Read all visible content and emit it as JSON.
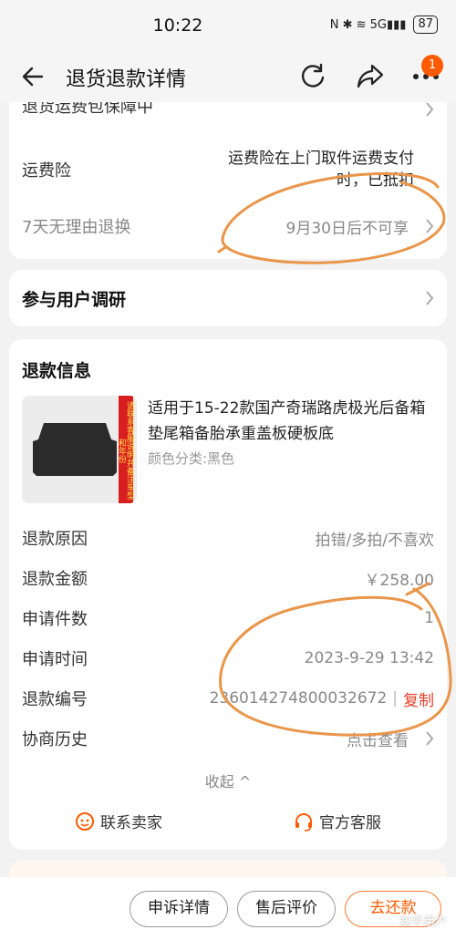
{
  "status_bar": {
    "time": "10:22",
    "icons": "N ✱ ≋ 5G▮▮▮",
    "battery": "87"
  },
  "nav": {
    "title": "退货退款详情",
    "badge": "1"
  },
  "top_card": {
    "row0_label": "退货运费包保障中",
    "freight_label": "运费险",
    "freight_value": "运费险在上门取件运费支付时，已抵扣",
    "return_label": "7天无理由退换",
    "return_value": "9月30日后不可享"
  },
  "survey": {
    "label": "参与用户调研"
  },
  "refund": {
    "title": "退款信息",
    "product": {
      "title": "适用于15-22款国产奇瑞路虎极光后备箱垫尾箱备胎承重盖板硬板底",
      "spec": "颜色分类:黑色",
      "strip_text": "请联系客服说明并备注车型和年份"
    },
    "rows": [
      {
        "label": "退款原因",
        "value": "拍错/多拍/不喜欢"
      },
      {
        "label": "退款金额",
        "value": "￥258.00"
      },
      {
        "label": "申请件数",
        "value": "1"
      },
      {
        "label": "申请时间",
        "value": "2023-9-29 13:42"
      },
      {
        "label": "退款编号",
        "value": "236014274800032672"
      },
      {
        "label": "协商历史",
        "value": "点击查看"
      }
    ],
    "copy_label": "复制",
    "separator": "|",
    "collapse_label": "收起 ^",
    "contact_seller": "联系卖家",
    "official_service": "官方客服"
  },
  "bottom": {
    "appeal": "申诉详情",
    "review": "售后评价",
    "pay": "去还款"
  },
  "watermark": "知乎用户",
  "colors": {
    "accent": "#ff5a00",
    "copy": "#e4402b",
    "annotation": "#e9954a"
  }
}
